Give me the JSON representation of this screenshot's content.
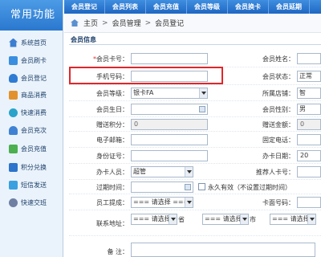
{
  "sidebar": {
    "title": "常用功能",
    "items": [
      {
        "label": "系统首页",
        "icon": "home-icon"
      },
      {
        "label": "会员刷卡",
        "icon": "card-icon"
      },
      {
        "label": "会员登记",
        "icon": "user-icon"
      },
      {
        "label": "商品消费",
        "icon": "cart-icon"
      },
      {
        "label": "快速消费",
        "icon": "fast-icon"
      },
      {
        "label": "会员充次",
        "icon": "member-icon"
      },
      {
        "label": "会员充值",
        "icon": "charge-icon"
      },
      {
        "label": "积分兑换",
        "icon": "points-icon"
      },
      {
        "label": "短信发送",
        "icon": "sms-icon"
      },
      {
        "label": "快速交班",
        "icon": "shift-icon"
      }
    ]
  },
  "topbar": {
    "tabs": [
      "会员登记",
      "会员列表",
      "会员充值",
      "会员等级",
      "会员换卡",
      "会员延期"
    ]
  },
  "breadcrumb": {
    "home": "主页",
    "sep": ">",
    "level1": "会员管理",
    "level2": "会员登记"
  },
  "section": {
    "title": "会员信息"
  },
  "form": {
    "card_no": {
      "label": "会员卡号：",
      "required": "*",
      "value": ""
    },
    "name": {
      "label": "会员姓名：",
      "value": ""
    },
    "phone": {
      "label": "手机号码：",
      "value": ""
    },
    "status": {
      "label": "会员状态：",
      "value": "正常"
    },
    "level": {
      "label": "会员等级：",
      "value": "银卡FA"
    },
    "store": {
      "label": "所属店铺：",
      "value": "智"
    },
    "birthday": {
      "label": "会员生日：",
      "value": ""
    },
    "gender": {
      "label": "会员性别：",
      "value": "男"
    },
    "gift_points": {
      "label": "赠送积分：",
      "value": "0"
    },
    "gift_amount": {
      "label": "赠送金额：",
      "value": "0"
    },
    "email": {
      "label": "电子邮箱：",
      "value": ""
    },
    "tel": {
      "label": "固定电话：",
      "value": ""
    },
    "id_no": {
      "label": "身份证号：",
      "value": ""
    },
    "card_date": {
      "label": "办卡日期：",
      "value": "20"
    },
    "operator": {
      "label": "办卡人员：",
      "value": "超管"
    },
    "referrer": {
      "label": "推荐人卡号：",
      "value": ""
    },
    "expire": {
      "label": "过期时间：",
      "value": "",
      "permanent": "永久有效（不设置过期时间）"
    },
    "staff": {
      "label": "员工提成：",
      "value": "=== 请选择 ==="
    },
    "surface_no": {
      "label": "卡面号码：",
      "value": ""
    },
    "address": {
      "label": "联系地址：",
      "province": "=== 请选择 ===",
      "province_unit": "省",
      "city": "=== 请选择 ===",
      "city_unit": "市",
      "district": "=== 请选择 ==="
    },
    "remark": {
      "label": "备 注：",
      "value": ""
    }
  }
}
